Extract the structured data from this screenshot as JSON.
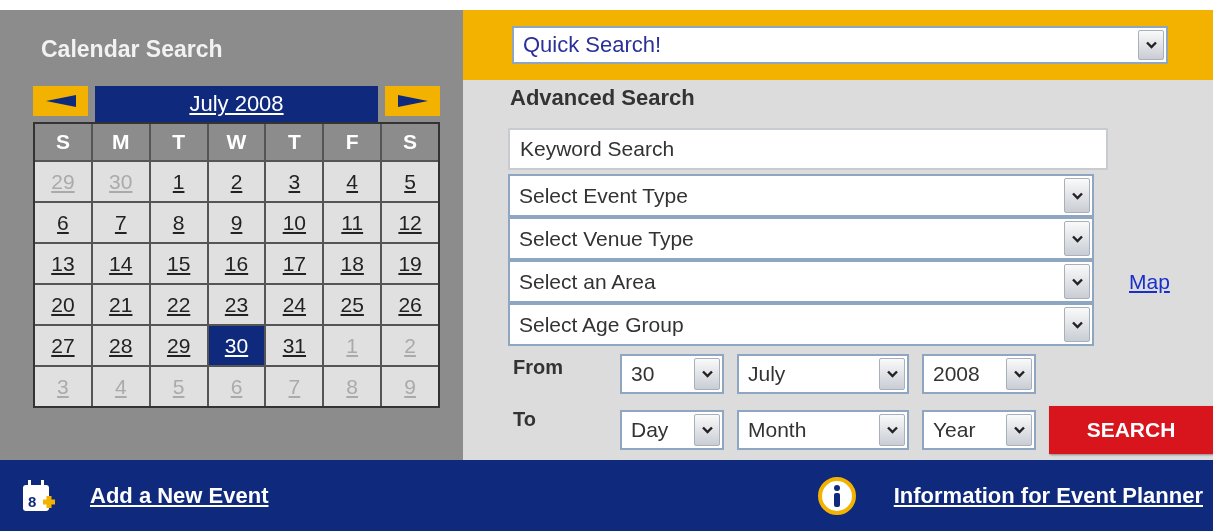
{
  "calendar": {
    "title": "Calendar Search",
    "month_label": "July 2008",
    "weekdays": [
      "S",
      "M",
      "T",
      "W",
      "T",
      "F",
      "S"
    ],
    "weeks": [
      {
        "days": [
          {
            "day": "29",
            "in_month": false,
            "selected": false
          },
          {
            "day": "30",
            "in_month": false,
            "selected": false
          },
          {
            "day": "1",
            "in_month": true,
            "selected": false
          },
          {
            "day": "2",
            "in_month": true,
            "selected": false
          },
          {
            "day": "3",
            "in_month": true,
            "selected": false
          },
          {
            "day": "4",
            "in_month": true,
            "selected": false
          },
          {
            "day": "5",
            "in_month": true,
            "selected": false
          }
        ]
      },
      {
        "days": [
          {
            "day": "6",
            "in_month": true,
            "selected": false
          },
          {
            "day": "7",
            "in_month": true,
            "selected": false
          },
          {
            "day": "8",
            "in_month": true,
            "selected": false
          },
          {
            "day": "9",
            "in_month": true,
            "selected": false
          },
          {
            "day": "10",
            "in_month": true,
            "selected": false
          },
          {
            "day": "11",
            "in_month": true,
            "selected": false
          },
          {
            "day": "12",
            "in_month": true,
            "selected": false
          }
        ]
      },
      {
        "days": [
          {
            "day": "13",
            "in_month": true,
            "selected": false
          },
          {
            "day": "14",
            "in_month": true,
            "selected": false
          },
          {
            "day": "15",
            "in_month": true,
            "selected": false
          },
          {
            "day": "16",
            "in_month": true,
            "selected": false
          },
          {
            "day": "17",
            "in_month": true,
            "selected": false
          },
          {
            "day": "18",
            "in_month": true,
            "selected": false
          },
          {
            "day": "19",
            "in_month": true,
            "selected": false
          }
        ]
      },
      {
        "days": [
          {
            "day": "20",
            "in_month": true,
            "selected": false
          },
          {
            "day": "21",
            "in_month": true,
            "selected": false
          },
          {
            "day": "22",
            "in_month": true,
            "selected": false
          },
          {
            "day": "23",
            "in_month": true,
            "selected": false
          },
          {
            "day": "24",
            "in_month": true,
            "selected": false
          },
          {
            "day": "25",
            "in_month": true,
            "selected": false
          },
          {
            "day": "26",
            "in_month": true,
            "selected": false
          }
        ]
      },
      {
        "days": [
          {
            "day": "27",
            "in_month": true,
            "selected": false
          },
          {
            "day": "28",
            "in_month": true,
            "selected": false
          },
          {
            "day": "29",
            "in_month": true,
            "selected": false
          },
          {
            "day": "30",
            "in_month": true,
            "selected": true
          },
          {
            "day": "31",
            "in_month": true,
            "selected": false
          },
          {
            "day": "1",
            "in_month": false,
            "selected": false
          },
          {
            "day": "2",
            "in_month": false,
            "selected": false
          }
        ]
      },
      {
        "days": [
          {
            "day": "3",
            "in_month": false,
            "selected": false
          },
          {
            "day": "4",
            "in_month": false,
            "selected": false
          },
          {
            "day": "5",
            "in_month": false,
            "selected": false
          },
          {
            "day": "6",
            "in_month": false,
            "selected": false
          },
          {
            "day": "7",
            "in_month": false,
            "selected": false
          },
          {
            "day": "8",
            "in_month": false,
            "selected": false
          },
          {
            "day": "9",
            "in_month": false,
            "selected": false
          }
        ]
      }
    ]
  },
  "quick_search": {
    "value": "Quick Search!"
  },
  "advanced_search": {
    "title": "Advanced Search",
    "keyword": {
      "placeholder": "Keyword Search"
    },
    "selects": [
      "Select Event Type",
      "Select Venue Type",
      "Select an Area",
      "Select Age Group"
    ],
    "map_link": "Map",
    "date_rows": [
      {
        "label": "From",
        "day": "30",
        "month": "July",
        "year": "2008"
      },
      {
        "label": "To",
        "day": "Day",
        "month": "Month",
        "year": "Year"
      }
    ],
    "search_button": "SEARCH"
  },
  "footer": {
    "add_event": "Add a New Event",
    "add_event_badge": "8",
    "info_link": "Information for Event Planner"
  }
}
